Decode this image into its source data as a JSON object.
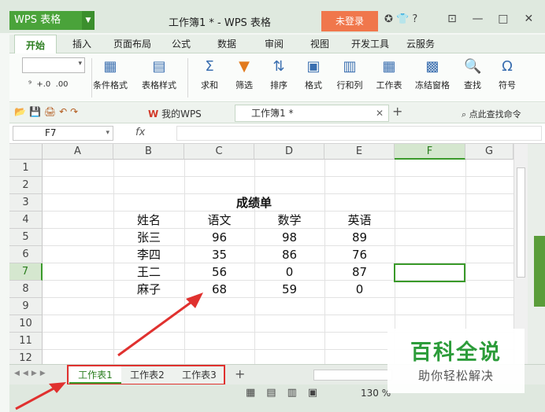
{
  "app": {
    "logo": "WPS 表格",
    "doc_title": "工作簿1 * - WPS 表格",
    "login_label": "未登录"
  },
  "menu_tabs": [
    "开始",
    "插入",
    "页面布局",
    "公式",
    "数据",
    "审阅",
    "视图",
    "开发工具",
    "云服务"
  ],
  "ribbon": {
    "buttons": [
      "条件格式",
      "表格样式",
      "求和",
      "筛选",
      "排序",
      "格式",
      "行和列",
      "工作表",
      "冻结窗格",
      "查找",
      "符号"
    ]
  },
  "quickbar": {
    "wps_tab": "我的WPS",
    "doc_tab": "工作簿1 *",
    "search_cmd": "点此查找命令"
  },
  "formula_bar": {
    "name_box": "F7",
    "fx_label": "fx",
    "formula": ""
  },
  "grid": {
    "columns": [
      "A",
      "B",
      "C",
      "D",
      "E",
      "F",
      "G"
    ],
    "rows": [
      "1",
      "2",
      "3",
      "4",
      "5",
      "6",
      "7",
      "8",
      "9",
      "10",
      "11",
      "12"
    ],
    "title": "成绩单",
    "headers": [
      "姓名",
      "语文",
      "数学",
      "英语"
    ],
    "data": [
      [
        "张三",
        "96",
        "98",
        "89"
      ],
      [
        "李四",
        "35",
        "86",
        "76"
      ],
      [
        "王二",
        "56",
        "0",
        "87"
      ],
      [
        "麻子",
        "68",
        "59",
        "0"
      ]
    ],
    "selected_cell": "F7"
  },
  "sheets": [
    "工作表1",
    "工作表2",
    "工作表3"
  ],
  "active_sheet": "工作表1",
  "status": {
    "zoom": "130 %"
  },
  "watermark": {
    "title": "百科全说",
    "subtitle": "助你轻松解决"
  },
  "colors": {
    "accent": "#3a9a2a",
    "highlight_box": "#e0312f"
  }
}
